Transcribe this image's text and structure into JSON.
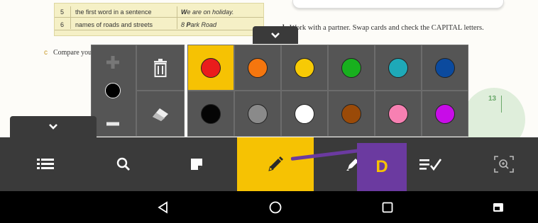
{
  "book": {
    "table_rows": [
      {
        "num": "5",
        "desc": "the first word in a sentence",
        "example_pre": "",
        "example_bold": "W",
        "example_post": "e are on holiday."
      },
      {
        "num": "6",
        "desc": "names of roads and streets",
        "example_pre": "8 ",
        "example_bold": "P",
        "example_post": "ark Road"
      }
    ],
    "exercise_b_number": "b",
    "exercise_b_text": "Work with a partner. Swap cards and check the CAPITAL letters.",
    "exercise_c_letter": "c",
    "exercise_c_text": "Compare your answers with a partner",
    "page_number": "13"
  },
  "picker": {
    "row1_colors": [
      "#ea1c1c",
      "#f5760e",
      "#f7ca05",
      "#18b01e",
      "#1ea9b8",
      "#0b4a9e"
    ],
    "row2_colors": [
      "#050505",
      "#8a8a8a",
      "#ffffff",
      "#9a4a08",
      "#f780b2",
      "#c80ce8"
    ],
    "selected_index": 0,
    "current_size_color": "#000000"
  },
  "toolbar": {
    "items": [
      {
        "name": "contents",
        "icon": "list-icon"
      },
      {
        "name": "search",
        "icon": "search-icon"
      },
      {
        "name": "notes",
        "icon": "sticky-note-icon"
      },
      {
        "name": "pen",
        "icon": "pen-icon"
      },
      {
        "name": "highlighter",
        "icon": "highlighter-icon"
      },
      {
        "name": "answers",
        "icon": "checklist-icon"
      },
      {
        "name": "zoom-area",
        "icon": "zoom-area-icon"
      }
    ],
    "active": "pen"
  },
  "annotation": {
    "label": "D",
    "color": "#6b3aa0"
  },
  "navbar": {
    "buttons": [
      "back",
      "home",
      "recents",
      "screenshot"
    ]
  }
}
